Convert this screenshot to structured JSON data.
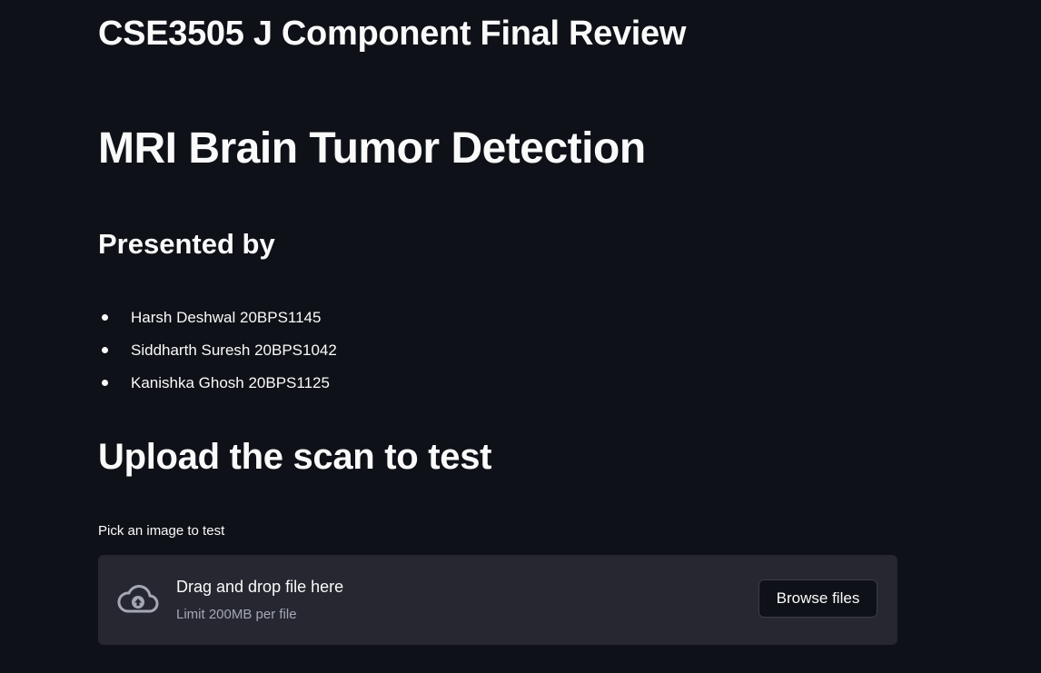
{
  "headers": {
    "course": "CSE3505 J Component Final Review",
    "title": "MRI Brain Tumor Detection",
    "presented_by": "Presented by",
    "upload": "Upload the scan to test"
  },
  "presenters": [
    "Harsh Deshwal 20BPS1145",
    "Siddharth Suresh 20BPS1042",
    "Kanishka Ghosh 20BPS1125"
  ],
  "uploader": {
    "label": "Pick an image to test",
    "drop_text": "Drag and drop file here",
    "limit_text": "Limit 200MB per file",
    "button_label": "Browse files",
    "icon": "cloud-upload-icon"
  },
  "colors": {
    "background": "#0e1117",
    "dropzone": "#262730",
    "text": "#fafafa",
    "muted": "#a3a8b4"
  }
}
